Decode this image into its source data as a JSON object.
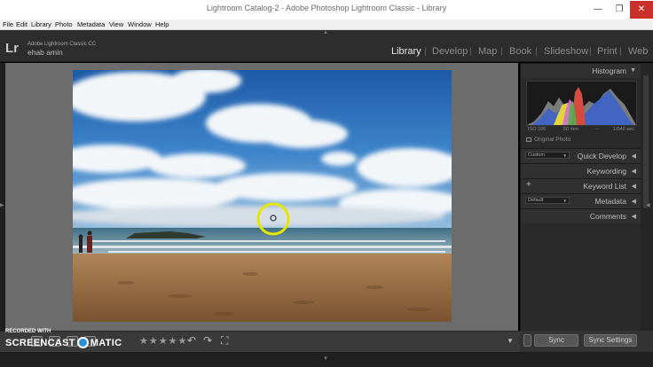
{
  "window": {
    "title": "Lightroom Catalog-2 - Adobe Photoshop Lightroom Classic - Library",
    "min_glyph": "—",
    "max_glyph": "❐",
    "close_glyph": "✕"
  },
  "menu": [
    "File",
    "Edit",
    "Library",
    "Photo",
    "Metadata",
    "View",
    "Window",
    "Help"
  ],
  "identity": {
    "logo": "Lr",
    "app_name": "Adobe Lightroom Classic CC",
    "user_name": "ehab amin"
  },
  "modules": [
    {
      "label": "Library",
      "active": true
    },
    {
      "label": "Develop",
      "active": false
    },
    {
      "label": "Map",
      "active": false
    },
    {
      "label": "Book",
      "active": false
    },
    {
      "label": "Slideshow",
      "active": false
    },
    {
      "label": "Print",
      "active": false
    },
    {
      "label": "Web",
      "active": false
    }
  ],
  "module_separator": "|",
  "right_panel": {
    "histogram": {
      "label": "Histogram",
      "iso": "ISO 100",
      "focal": "50 mm",
      "aperture": "--",
      "shutter": "1/640 sec",
      "original_photo": "Original Photo"
    },
    "quick_develop": {
      "label": "Quick Develop",
      "preset": "Custom"
    },
    "keywording": {
      "label": "Keywording"
    },
    "keyword_list": {
      "label": "Keyword List",
      "plus": "+"
    },
    "metadata": {
      "label": "Metadata",
      "preset": "Default"
    },
    "comments": {
      "label": "Comments"
    },
    "collapse_glyph": "◀",
    "expand_glyph": "▼"
  },
  "bottom_right": {
    "sync": "Sync",
    "sync_settings": "Sync Settings"
  },
  "toolbar": {
    "stars": "★★★★★",
    "rotate_left": "↶",
    "rotate_right": "↷",
    "crop_icon": "⛶",
    "dropdown": "▼"
  },
  "watermark": {
    "recorded_with": "RECORDED WITH",
    "brand_left": "SCREENCAST",
    "brand_right": "MATIC"
  },
  "panel_triangles": {
    "top": "▲",
    "bottom": "▼",
    "left": "◀",
    "right": "▶"
  },
  "colors": {
    "active_module": "#e8e8e8",
    "inactive_module": "#8d8d8d",
    "close_button": "#c7302b",
    "zoom_ring": "#e6e600"
  }
}
